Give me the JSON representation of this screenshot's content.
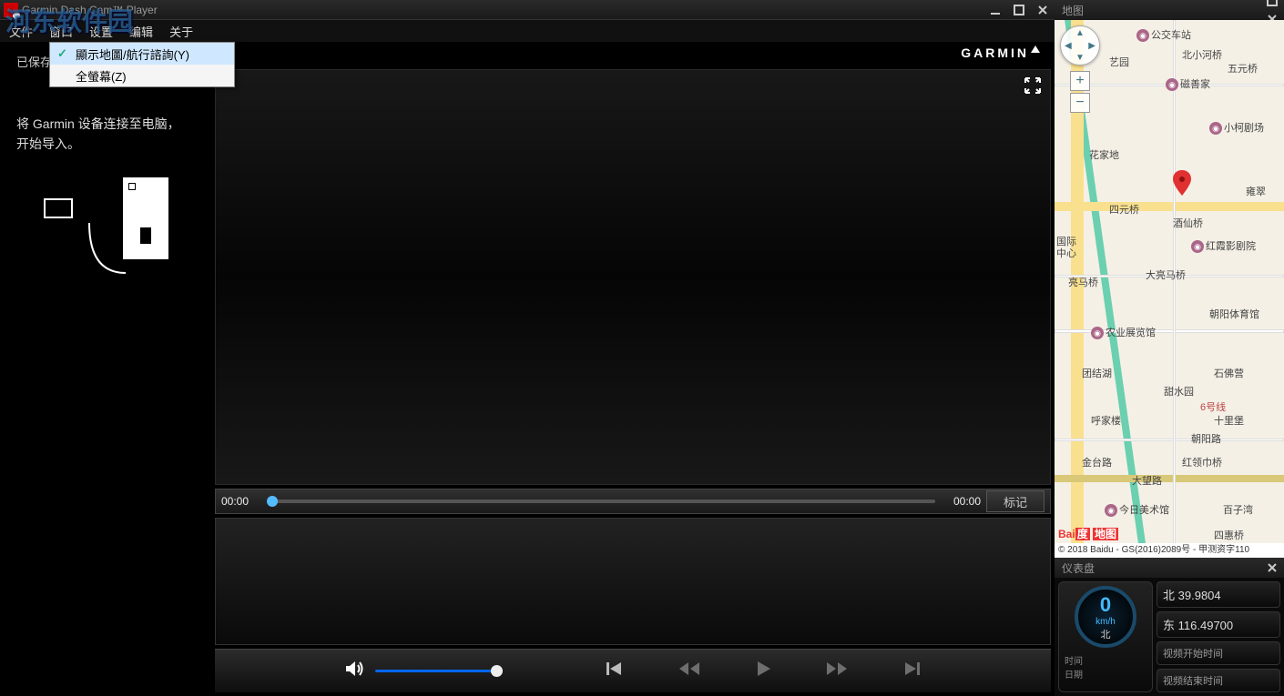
{
  "app": {
    "title": "Garmin Dash Cam™ Player",
    "watermark": "河东软件园"
  },
  "menu": {
    "file": "文件",
    "window": "窗口",
    "settings": "设置",
    "edit": "编辑",
    "about": "关于"
  },
  "dropdown": {
    "show_map": "顯示地圖/航行諮詢(Y)",
    "fullscreen": "全螢幕(Z)"
  },
  "sidebar": {
    "saved": "已保存",
    "import_line1": "将 Garmin 设备连接至电脑，",
    "import_line2": "开始导入。"
  },
  "brand": "GARMIN",
  "timeline": {
    "start": "00:00",
    "end": "00:00",
    "marker": "标记"
  },
  "map": {
    "title": "地图",
    "zoom_in": "+",
    "zoom_out": "−",
    "attrib": "© 2018 Baidu - GS(2016)2089号 - 甲测资字110",
    "baidu_bai": "Bai",
    "baidu_du": "度",
    "baidu_map": "地图",
    "labels": {
      "bus_station": "公交车站",
      "art_garden": "艺园",
      "beixiaohe": "北小河桥",
      "wuyuan": "五元桥",
      "cishan": "磁善家",
      "xiaoke": "小柯剧场",
      "huajia": "花家地",
      "siyuanqiao": "四元桥",
      "jiuxian": "酒仙桥",
      "yongcui": "雍翠",
      "hongxia": "红霞影剧院",
      "guoji": "国际",
      "zhongxin": "中心",
      "liangma": "亮马桥",
      "daliang": "大亮马桥",
      "chaoyang": "朝阳体育馆",
      "nongzhan": "农业展览馆",
      "tianshui": "甜水园",
      "shifo": "石佛营",
      "tuanjie": "团结湖",
      "hujia": "呼家楼",
      "shibao": "十里堡",
      "line6": "6号线",
      "chaoyanglu": "朝阳路",
      "jintai": "金台路",
      "honglingin": "红领巾桥",
      "dawang": "大望路",
      "bali": "百子湾",
      "jinri": "今日美术馆",
      "sihui": "四惠桥"
    }
  },
  "dashboard": {
    "title": "仪表盘",
    "speed_val": "0",
    "speed_unit": "km/h",
    "direction": "北",
    "time_label": "时间",
    "date_label": "日期",
    "lat_prefix": "北",
    "lat_val": "39.9804",
    "lon_prefix": "东",
    "lon_val": "116.49700",
    "video_start": "视频开始时间",
    "video_end": "视频结束时间"
  }
}
